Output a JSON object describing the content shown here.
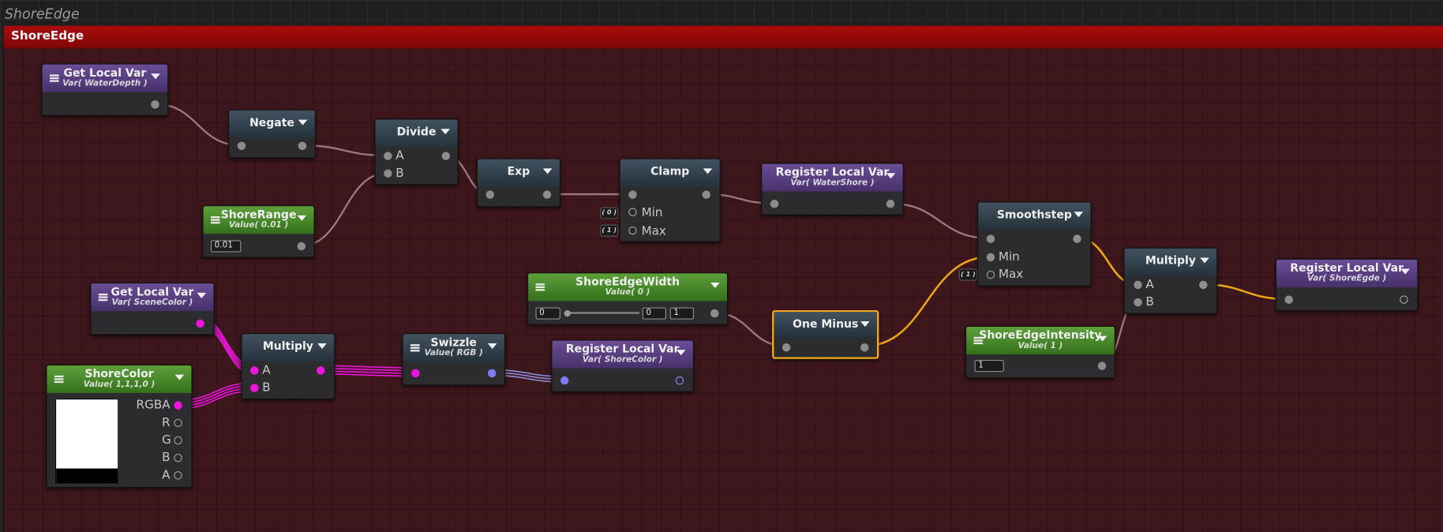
{
  "canvas": {
    "title": "ShoreEdge"
  },
  "group": {
    "title": "ShoreEdge"
  },
  "colors": {
    "group_header": "#a80c0c",
    "group_body": "#3d171c",
    "selection": "#f2a91c",
    "wire_color": "#ee14dc",
    "wire_float": "#9a7a7e",
    "wire_active": "#e8a616",
    "wire_vec": "#8c8cd6"
  },
  "nodes": {
    "get_local_var_1": {
      "title": "Get Local Var",
      "subtitle": "Var( WaterDepth )"
    },
    "negate": {
      "title": "Negate"
    },
    "divide": {
      "title": "Divide",
      "in_a": "A",
      "in_b": "B"
    },
    "shore_range": {
      "title": "ShoreRange",
      "subtitle": "Value( 0.01 )",
      "value": "0.01"
    },
    "exp": {
      "title": "Exp"
    },
    "clamp": {
      "title": "Clamp",
      "min_label": "Min",
      "max_label": "Max",
      "min_default": "( 0 )",
      "max_default": "( 1 )"
    },
    "register_local_var_1": {
      "title": "Register Local Var",
      "subtitle": "Var( WaterShore )"
    },
    "smoothstep": {
      "title": "Smoothstep",
      "min_label": "Min",
      "max_label": "Max",
      "max_default": "( 1 )"
    },
    "multiply_2": {
      "title": "Multiply",
      "in_a": "A",
      "in_b": "B"
    },
    "register_local_var_3": {
      "title": "Register Local Var",
      "subtitle": "Var( ShoreEgde )"
    },
    "get_local_var_2": {
      "title": "Get Local Var",
      "subtitle": "Var( SceneColor )"
    },
    "shore_color": {
      "title": "ShoreColor",
      "subtitle": "Value( 1,1,1,0 )",
      "out_rgba": "RGBA",
      "out_r": "R",
      "out_g": "G",
      "out_b": "B",
      "out_a": "A",
      "swatch_color": "#ffffff"
    },
    "multiply_1": {
      "title": "Multiply",
      "in_a": "A",
      "in_b": "B"
    },
    "swizzle": {
      "title": "Swizzle",
      "subtitle": "Value( RGB )"
    },
    "register_local_var_2": {
      "title": "Register Local Var",
      "subtitle": "Var( ShoreColor )"
    },
    "shore_edge_width": {
      "title": "ShoreEdgeWidth",
      "subtitle": "Value( 0 )",
      "min": "0",
      "value": "0",
      "max": "1"
    },
    "one_minus": {
      "title": "One Minus"
    },
    "shore_edge_intensity": {
      "title": "ShoreEdgeIntensity",
      "subtitle": "Value( 1 )",
      "value": "1"
    }
  }
}
